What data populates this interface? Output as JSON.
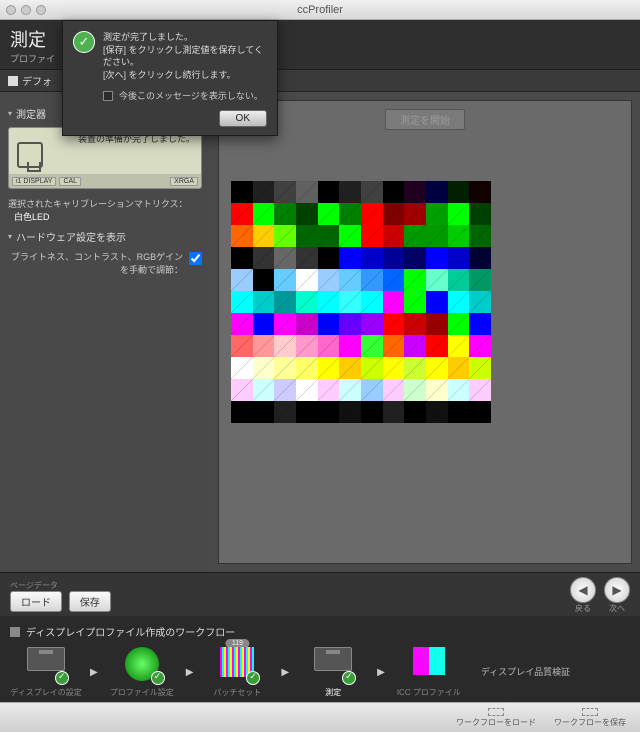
{
  "window": {
    "title": "ccProfiler"
  },
  "header": {
    "title": "測定",
    "subtitle": "プロファイ"
  },
  "tab": {
    "label": "デフォ"
  },
  "dialog": {
    "line1": "測定が完了しました。",
    "line2": "[保存] をクリックし測定値を保存してください。",
    "line3": "[次へ] をクリックし続行します。",
    "dont_show": "今後このメッセージを表示しない。",
    "ok": "OK"
  },
  "sidebar": {
    "section_device": "測定器",
    "device_ready": "装置の準備が完了しました。",
    "device_badges": {
      "a": "i1 DISPLAY",
      "b": "CAL",
      "c": "XRGA"
    },
    "matrix_label": "選択されたキャリブレーションマトリクス：",
    "matrix_value": "白色LED",
    "section_hw": "ハードウェア設定を表示",
    "manual_label": "ブライトネス、コントラスト、RGBゲインを手動で調節："
  },
  "canvas": {
    "start_btn": "測定を開始"
  },
  "footer": {
    "legend": "ページデータ",
    "load": "ロード",
    "save": "保存",
    "back": "戻る",
    "next": "次へ"
  },
  "workflow": {
    "title": "ディスプレイプロファイル作成のワークフロー",
    "items": [
      {
        "label": "ディスプレイの設定"
      },
      {
        "label": "プロファイル設定"
      },
      {
        "label": "パッチセット",
        "badge": "119"
      },
      {
        "label": "測定"
      },
      {
        "label": "ICC プロファイル"
      }
    ],
    "side": "ディスプレイ品質検証"
  },
  "bottom": {
    "load_wf": "ワークフローをロード",
    "save_wf": "ワークフローを保存"
  },
  "chart_data": {
    "type": "heatmap",
    "note": "12×11 color calibration patch grid (approx colors shown on screen)",
    "cols": 12,
    "rows": 11,
    "colors": [
      [
        "#000000",
        "#202020",
        "#404040",
        "#606060",
        "#000000",
        "#202020",
        "#404040",
        "#000000",
        "#200020",
        "#000040",
        "#002000",
        "#100000"
      ],
      [
        "#ff0000",
        "#00ff00",
        "#008000",
        "#004000",
        "#00ff00",
        "#008000",
        "#ff0000",
        "#800000",
        "#a00000",
        "#00a000",
        "#00ff00",
        "#004000"
      ],
      [
        "#ff6600",
        "#ffcc00",
        "#66ff00",
        "#006600",
        "#006600",
        "#00ff00",
        "#ff0000",
        "#cc0000",
        "#009900",
        "#009900",
        "#00cc00",
        "#006600"
      ],
      [
        "#000000",
        "#333333",
        "#666666",
        "#333333",
        "#000000",
        "#0000ff",
        "#0000cc",
        "#000099",
        "#000066",
        "#0000ff",
        "#0000cc",
        "#000033"
      ],
      [
        "#99ccff",
        "#000000",
        "#66ccff",
        "#ffffff",
        "#99ccff",
        "#66ccff",
        "#3399ff",
        "#0066ff",
        "#00ff00",
        "#66ffcc",
        "#00cc99",
        "#009966"
      ],
      [
        "#00ffff",
        "#00cccc",
        "#009999",
        "#00ffcc",
        "#00ffff",
        "#33ffff",
        "#00ffff",
        "#ff00ff",
        "#00ff00",
        "#0000ff",
        "#00ffff",
        "#00cccc"
      ],
      [
        "#ff00ff",
        "#0000ff",
        "#ff00ff",
        "#cc00cc",
        "#0000ff",
        "#6600ff",
        "#9900ff",
        "#ff0000",
        "#cc0000",
        "#990000",
        "#00ff00",
        "#0000ff"
      ],
      [
        "#ff6666",
        "#ff9999",
        "#ffcccc",
        "#ff99cc",
        "#ff66cc",
        "#ff00ff",
        "#33ff33",
        "#ff6600",
        "#cc00ff",
        "#ff0000",
        "#ffff00",
        "#ff00ff"
      ],
      [
        "#ffffff",
        "#ffffcc",
        "#ffff99",
        "#ffff66",
        "#ffff00",
        "#ffcc00",
        "#ccff00",
        "#ffff00",
        "#ccff33",
        "#ffff00",
        "#ffcc00",
        "#ccff00"
      ],
      [
        "#ffccff",
        "#ccffff",
        "#ccccff",
        "#ffffff",
        "#ffccff",
        "#ccffff",
        "#99ccff",
        "#ffccff",
        "#ccffcc",
        "#ffffcc",
        "#ccffff",
        "#ffccff"
      ],
      [
        "#000000",
        "#000000",
        "#202020",
        "#000000",
        "#000000",
        "#101010",
        "#000000",
        "#202020",
        "#000000",
        "#101010",
        "#000000",
        "#000000"
      ]
    ]
  }
}
